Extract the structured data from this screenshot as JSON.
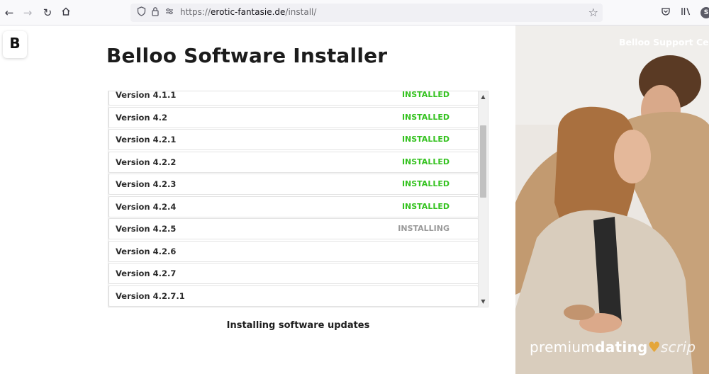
{
  "browser": {
    "url_prefix": "https://",
    "url_host": "erotic-fantasie.de",
    "url_path": "/install/",
    "icons": [
      "back-arrow-icon",
      "forward-arrow-icon",
      "reload-icon",
      "home-icon",
      "shield-icon",
      "lock-icon",
      "permissions-icon",
      "bookmark-star-icon",
      "pocket-icon",
      "library-icon",
      "profile-icon"
    ],
    "profile_letter": "S"
  },
  "logo": {
    "letter": "B"
  },
  "page": {
    "title": "Belloo Software Installer",
    "caption": "Installing software updates"
  },
  "versions": [
    {
      "label": "Version 4.1.1",
      "status": "INSTALLED"
    },
    {
      "label": "Version 4.2",
      "status": "INSTALLED"
    },
    {
      "label": "Version 4.2.1",
      "status": "INSTALLED"
    },
    {
      "label": "Version 4.2.2",
      "status": "INSTALLED"
    },
    {
      "label": "Version 4.2.3",
      "status": "INSTALLED"
    },
    {
      "label": "Version 4.2.4",
      "status": "INSTALLED"
    },
    {
      "label": "Version 4.2.5",
      "status": "INSTALLING"
    },
    {
      "label": "Version 4.2.6",
      "status": ""
    },
    {
      "label": "Version 4.2.7",
      "status": ""
    },
    {
      "label": "Version 4.2.7.1",
      "status": ""
    }
  ],
  "colors": {
    "installed": "#34c21f",
    "installing": "#9a9a9a"
  },
  "hero": {
    "support_text": "Belloo Support Cen",
    "brand_light": "premium",
    "brand_bold": "dating",
    "brand_script": "scrip",
    "heart": "♥"
  }
}
